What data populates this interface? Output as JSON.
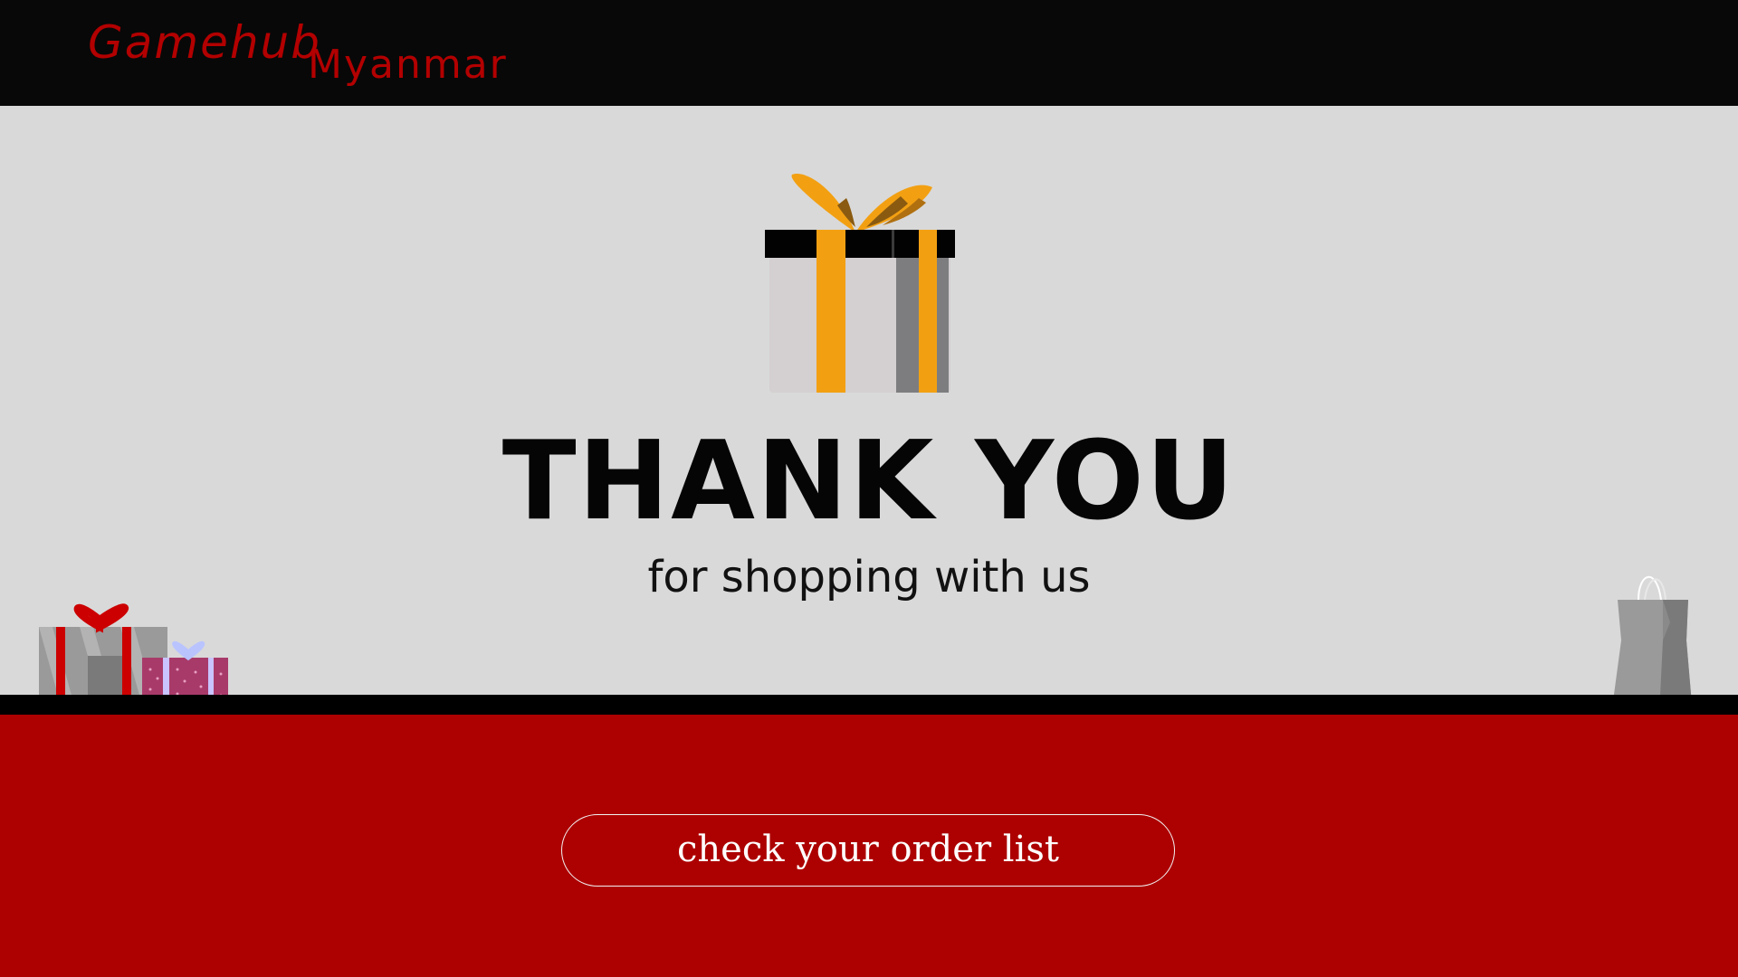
{
  "header": {
    "brand_main": "Gamehub",
    "brand_sub": "Myanmar"
  },
  "hero": {
    "title": "THANK YOU",
    "subtitle": "for shopping with us"
  },
  "footer": {
    "order_button_label": "check your order list"
  },
  "icons": {
    "hero": "gift-box-icon",
    "left_decor": "gift-boxes-icon",
    "right_decor": "shopping-bag-icon"
  },
  "colors": {
    "brand_red": "#b30000",
    "footer_red": "#ad0000",
    "topbar": "#080808",
    "background": "#d9d9d9",
    "ribbon": "#f2a012"
  }
}
